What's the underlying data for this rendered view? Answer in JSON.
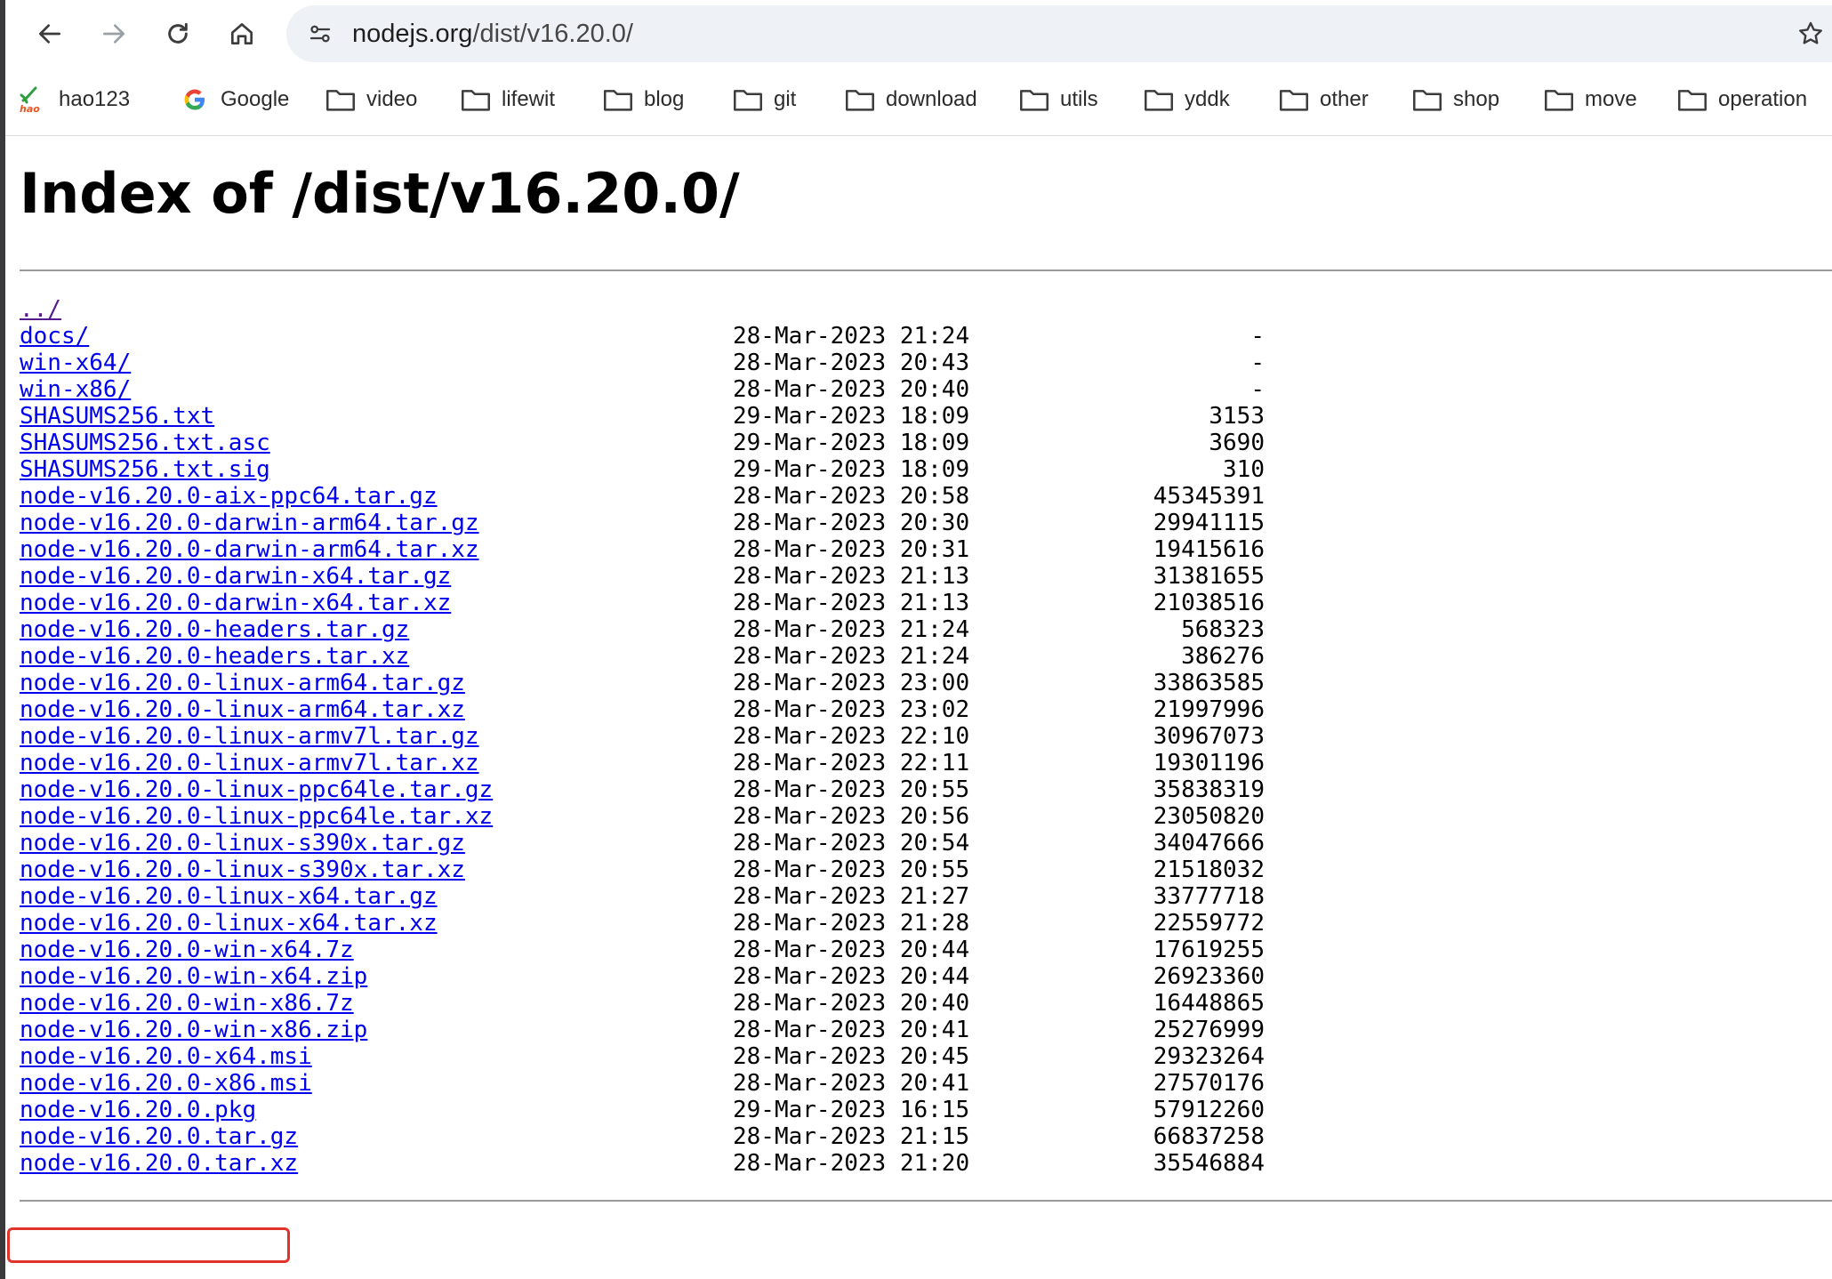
{
  "browser": {
    "url_host": "nodejs.org",
    "url_path": "/dist/v16.20.0/"
  },
  "bookmarks": [
    {
      "label": "hao123",
      "icon": "hao123-icon"
    },
    {
      "label": "Google",
      "icon": "google-icon"
    },
    {
      "label": "video",
      "icon": "folder-icon"
    },
    {
      "label": "lifewit",
      "icon": "folder-icon"
    },
    {
      "label": "blog",
      "icon": "folder-icon"
    },
    {
      "label": "git",
      "icon": "folder-icon"
    },
    {
      "label": "download",
      "icon": "folder-icon"
    },
    {
      "label": "utils",
      "icon": "folder-icon"
    },
    {
      "label": "yddk",
      "icon": "folder-icon"
    },
    {
      "label": "other",
      "icon": "folder-icon"
    },
    {
      "label": "shop",
      "icon": "folder-icon"
    },
    {
      "label": "move",
      "icon": "folder-icon"
    },
    {
      "label": "operation",
      "icon": "folder-icon"
    }
  ],
  "page": {
    "title": "Index of /dist/v16.20.0/",
    "entries": [
      {
        "name": "../",
        "date": "",
        "size": ""
      },
      {
        "name": "docs/",
        "date": "28-Mar-2023 21:24",
        "size": "-"
      },
      {
        "name": "win-x64/",
        "date": "28-Mar-2023 20:43",
        "size": "-"
      },
      {
        "name": "win-x86/",
        "date": "28-Mar-2023 20:40",
        "size": "-"
      },
      {
        "name": "SHASUMS256.txt",
        "date": "29-Mar-2023 18:09",
        "size": "3153"
      },
      {
        "name": "SHASUMS256.txt.asc",
        "date": "29-Mar-2023 18:09",
        "size": "3690"
      },
      {
        "name": "SHASUMS256.txt.sig",
        "date": "29-Mar-2023 18:09",
        "size": "310"
      },
      {
        "name": "node-v16.20.0-aix-ppc64.tar.gz",
        "date": "28-Mar-2023 20:58",
        "size": "45345391"
      },
      {
        "name": "node-v16.20.0-darwin-arm64.tar.gz",
        "date": "28-Mar-2023 20:30",
        "size": "29941115"
      },
      {
        "name": "node-v16.20.0-darwin-arm64.tar.xz",
        "date": "28-Mar-2023 20:31",
        "size": "19415616"
      },
      {
        "name": "node-v16.20.0-darwin-x64.tar.gz",
        "date": "28-Mar-2023 21:13",
        "size": "31381655"
      },
      {
        "name": "node-v16.20.0-darwin-x64.tar.xz",
        "date": "28-Mar-2023 21:13",
        "size": "21038516"
      },
      {
        "name": "node-v16.20.0-headers.tar.gz",
        "date": "28-Mar-2023 21:24",
        "size": "568323"
      },
      {
        "name": "node-v16.20.0-headers.tar.xz",
        "date": "28-Mar-2023 21:24",
        "size": "386276"
      },
      {
        "name": "node-v16.20.0-linux-arm64.tar.gz",
        "date": "28-Mar-2023 23:00",
        "size": "33863585"
      },
      {
        "name": "node-v16.20.0-linux-arm64.tar.xz",
        "date": "28-Mar-2023 23:02",
        "size": "21997996"
      },
      {
        "name": "node-v16.20.0-linux-armv7l.tar.gz",
        "date": "28-Mar-2023 22:10",
        "size": "30967073"
      },
      {
        "name": "node-v16.20.0-linux-armv7l.tar.xz",
        "date": "28-Mar-2023 22:11",
        "size": "19301196"
      },
      {
        "name": "node-v16.20.0-linux-ppc64le.tar.gz",
        "date": "28-Mar-2023 20:55",
        "size": "35838319"
      },
      {
        "name": "node-v16.20.0-linux-ppc64le.tar.xz",
        "date": "28-Mar-2023 20:56",
        "size": "23050820"
      },
      {
        "name": "node-v16.20.0-linux-s390x.tar.gz",
        "date": "28-Mar-2023 20:54",
        "size": "34047666"
      },
      {
        "name": "node-v16.20.0-linux-s390x.tar.xz",
        "date": "28-Mar-2023 20:55",
        "size": "21518032"
      },
      {
        "name": "node-v16.20.0-linux-x64.tar.gz",
        "date": "28-Mar-2023 21:27",
        "size": "33777718"
      },
      {
        "name": "node-v16.20.0-linux-x64.tar.xz",
        "date": "28-Mar-2023 21:28",
        "size": "22559772"
      },
      {
        "name": "node-v16.20.0-win-x64.7z",
        "date": "28-Mar-2023 20:44",
        "size": "17619255"
      },
      {
        "name": "node-v16.20.0-win-x64.zip",
        "date": "28-Mar-2023 20:44",
        "size": "26923360"
      },
      {
        "name": "node-v16.20.0-win-x86.7z",
        "date": "28-Mar-2023 20:40",
        "size": "16448865"
      },
      {
        "name": "node-v16.20.0-win-x86.zip",
        "date": "28-Mar-2023 20:41",
        "size": "25276999"
      },
      {
        "name": "node-v16.20.0-x64.msi",
        "date": "28-Mar-2023 20:45",
        "size": "29323264"
      },
      {
        "name": "node-v16.20.0-x86.msi",
        "date": "28-Mar-2023 20:41",
        "size": "27570176"
      },
      {
        "name": "node-v16.20.0.pkg",
        "date": "29-Mar-2023 16:15",
        "size": "57912260"
      },
      {
        "name": "node-v16.20.0.tar.gz",
        "date": "28-Mar-2023 21:15",
        "size": "66837258"
      },
      {
        "name": "node-v16.20.0.tar.xz",
        "date": "28-Mar-2023 21:20",
        "size": "35546884"
      }
    ]
  },
  "colors": {
    "link": "#0000ee",
    "visited_link": "#551a8b",
    "highlight_box": "#e0342a",
    "omnibox_bg": "#eef1f6"
  }
}
